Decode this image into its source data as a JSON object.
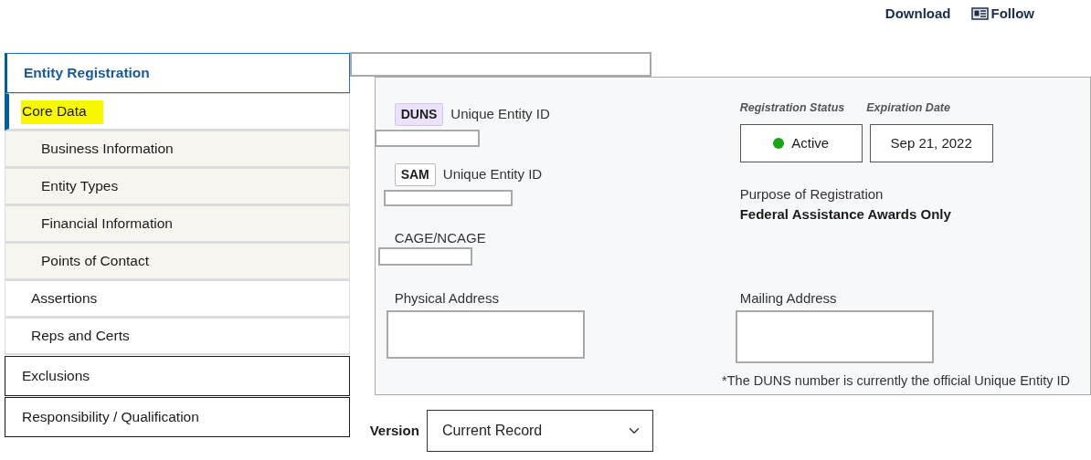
{
  "header_links": [
    {
      "kind": "text",
      "label": "Download"
    },
    {
      "kind": "icon",
      "label": "Follow"
    }
  ],
  "sidebar": {
    "items": [
      {
        "label": "Entity Registration",
        "selected": true,
        "highlighted": false,
        "children": [
          {
            "label": "Core Data",
            "selected": true,
            "highlighted": true,
            "children": [
              {
                "label": "Business Information",
                "selected": false,
                "highlighted": false
              },
              {
                "label": "Entity Types",
                "selected": false,
                "highlighted": false
              },
              {
                "label": "Financial Information",
                "selected": false,
                "highlighted": false
              },
              {
                "label": "Points of Contact",
                "selected": false,
                "highlighted": false
              }
            ]
          },
          {
            "label": "Assertions",
            "selected": false,
            "highlighted": false
          },
          {
            "label": "Reps and Certs",
            "selected": false,
            "highlighted": false
          }
        ]
      },
      {
        "label": "Exclusions",
        "selected": false,
        "highlighted": false
      },
      {
        "label": "Responsibility / Qualification",
        "selected": false,
        "highlighted": false
      }
    ]
  },
  "ids": [
    {
      "tag": "DUNS",
      "tag_highlighted": true,
      "label": "Unique Entity ID"
    },
    {
      "tag": "SAM",
      "tag_highlighted": false,
      "label": "Unique Entity ID"
    },
    {
      "label": "CAGE/NCAGE"
    }
  ],
  "registration_status": {
    "label": "Registration Status",
    "value": "Active",
    "color": "#1aa41a"
  },
  "expiration_date": {
    "label": "Expiration Date",
    "value": "Sep 21, 2022"
  },
  "purpose": {
    "label": "Purpose of Registration",
    "value": "Federal Assistance Awards Only"
  },
  "addresses": [
    {
      "label": "Physical Address"
    },
    {
      "label": "Mailing Address"
    }
  ],
  "footnote": "*The DUNS number is currently the official Unique Entity ID",
  "version": {
    "label": "Version",
    "value": "Current Record"
  }
}
